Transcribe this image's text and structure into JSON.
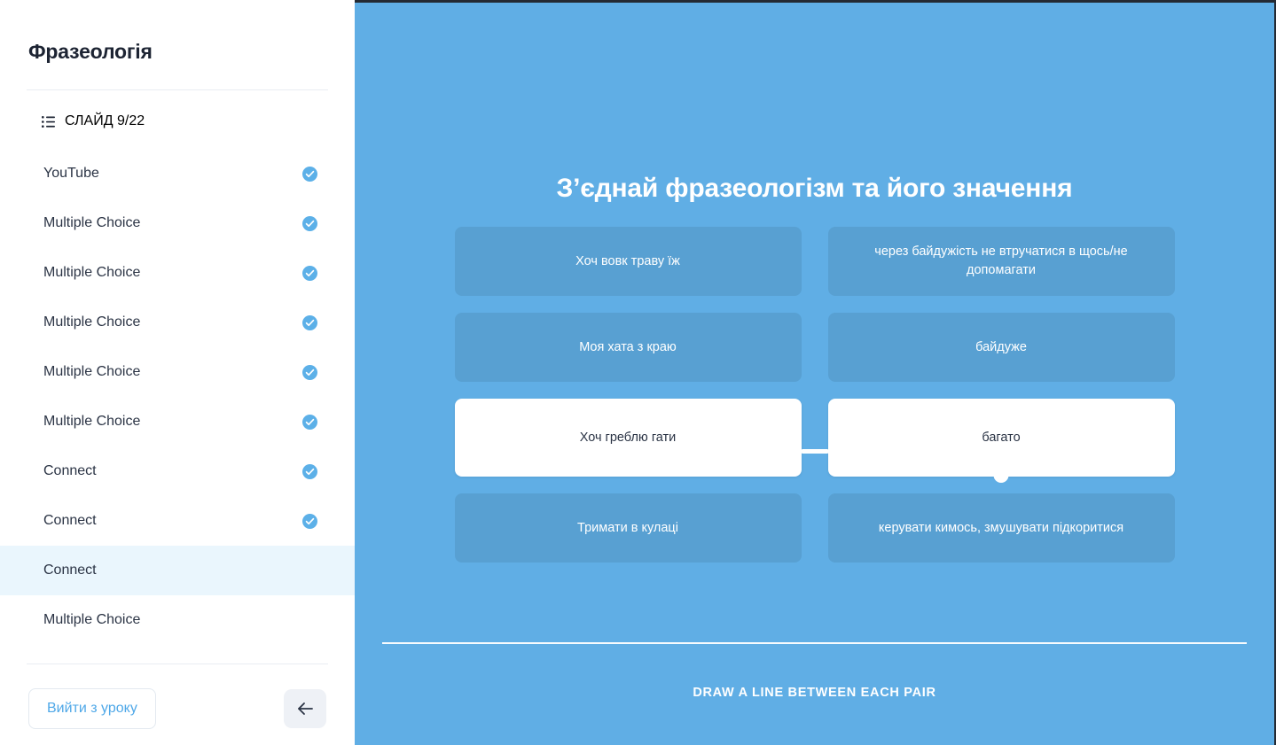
{
  "sidebar": {
    "title": "Фразеологія",
    "slide_counter": {
      "icon": "list-icon",
      "label": "СЛАЙД 9/22"
    },
    "items": [
      {
        "label": "YouTube",
        "completed": true,
        "active": false
      },
      {
        "label": "Multiple Choice",
        "completed": true,
        "active": false
      },
      {
        "label": "Multiple Choice",
        "completed": true,
        "active": false
      },
      {
        "label": "Multiple Choice",
        "completed": true,
        "active": false
      },
      {
        "label": "Multiple Choice",
        "completed": true,
        "active": false
      },
      {
        "label": "Multiple Choice",
        "completed": true,
        "active": false
      },
      {
        "label": "Connect",
        "completed": true,
        "active": false
      },
      {
        "label": "Connect",
        "completed": true,
        "active": false
      },
      {
        "label": "Connect",
        "completed": false,
        "active": true
      },
      {
        "label": "Multiple Choice",
        "completed": false,
        "active": false
      }
    ],
    "footer": {
      "exit_label": "Вийти з уроку",
      "back_icon": "arrow-left-icon"
    }
  },
  "slide": {
    "title": "З’єднай фразеологізм та його значення",
    "instruction": "DRAW A LINE BETWEEN EACH PAIR",
    "pairs": [
      {
        "left": "Хоч вовк траву їж",
        "right": "через байдужість не втручатися в щось/не допомагати",
        "matched": false
      },
      {
        "left": "Моя хата з краю",
        "right": "байдуже",
        "matched": false
      },
      {
        "left": "Хоч греблю гати",
        "right": "багато",
        "matched": true
      },
      {
        "left": "Тримати в кулаці",
        "right": "керувати кимось, змушувати підкоритися",
        "matched": false
      }
    ]
  },
  "colors": {
    "slide_background": "#60aee5",
    "card_background": "#58a0d2",
    "card_matched_background": "#ffffff",
    "accent": "#4fa8e8",
    "active_item_background": "#eaf6fd",
    "text_dark": "#2b3445"
  }
}
